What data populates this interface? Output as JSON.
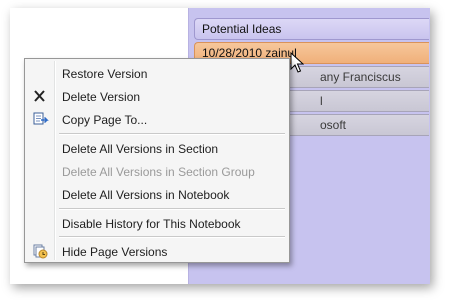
{
  "page_tabs": [
    {
      "label": "Potential Ideas"
    },
    {
      "label": "10/28/2010 zainul"
    },
    {
      "label": "any Franciscus"
    },
    {
      "label": "l"
    },
    {
      "label": "osoft"
    }
  ],
  "context_menu": {
    "items": [
      {
        "label": "Restore Version",
        "icon": "",
        "enabled": true
      },
      {
        "label": "Delete Version",
        "icon": "close-icon",
        "enabled": true
      },
      {
        "label": "Copy Page To...",
        "icon": "copy-page-icon",
        "enabled": true
      },
      {
        "label": "Delete All Versions in Section",
        "icon": "",
        "enabled": true
      },
      {
        "label": "Delete All Versions in Section Group",
        "icon": "",
        "enabled": false
      },
      {
        "label": "Delete All Versions in Notebook",
        "icon": "",
        "enabled": true
      },
      {
        "label": "Disable History for This Notebook",
        "icon": "",
        "enabled": true
      },
      {
        "label": "Hide Page Versions",
        "icon": "page-versions-icon",
        "enabled": true
      }
    ]
  },
  "colors": {
    "tabs_background": "#c7c3ef",
    "selected_tab": "#f0b07a",
    "version_tab": "#c9c7d4",
    "menu_background": "#f5f5f5",
    "disabled_text": "#9a9a9a"
  }
}
